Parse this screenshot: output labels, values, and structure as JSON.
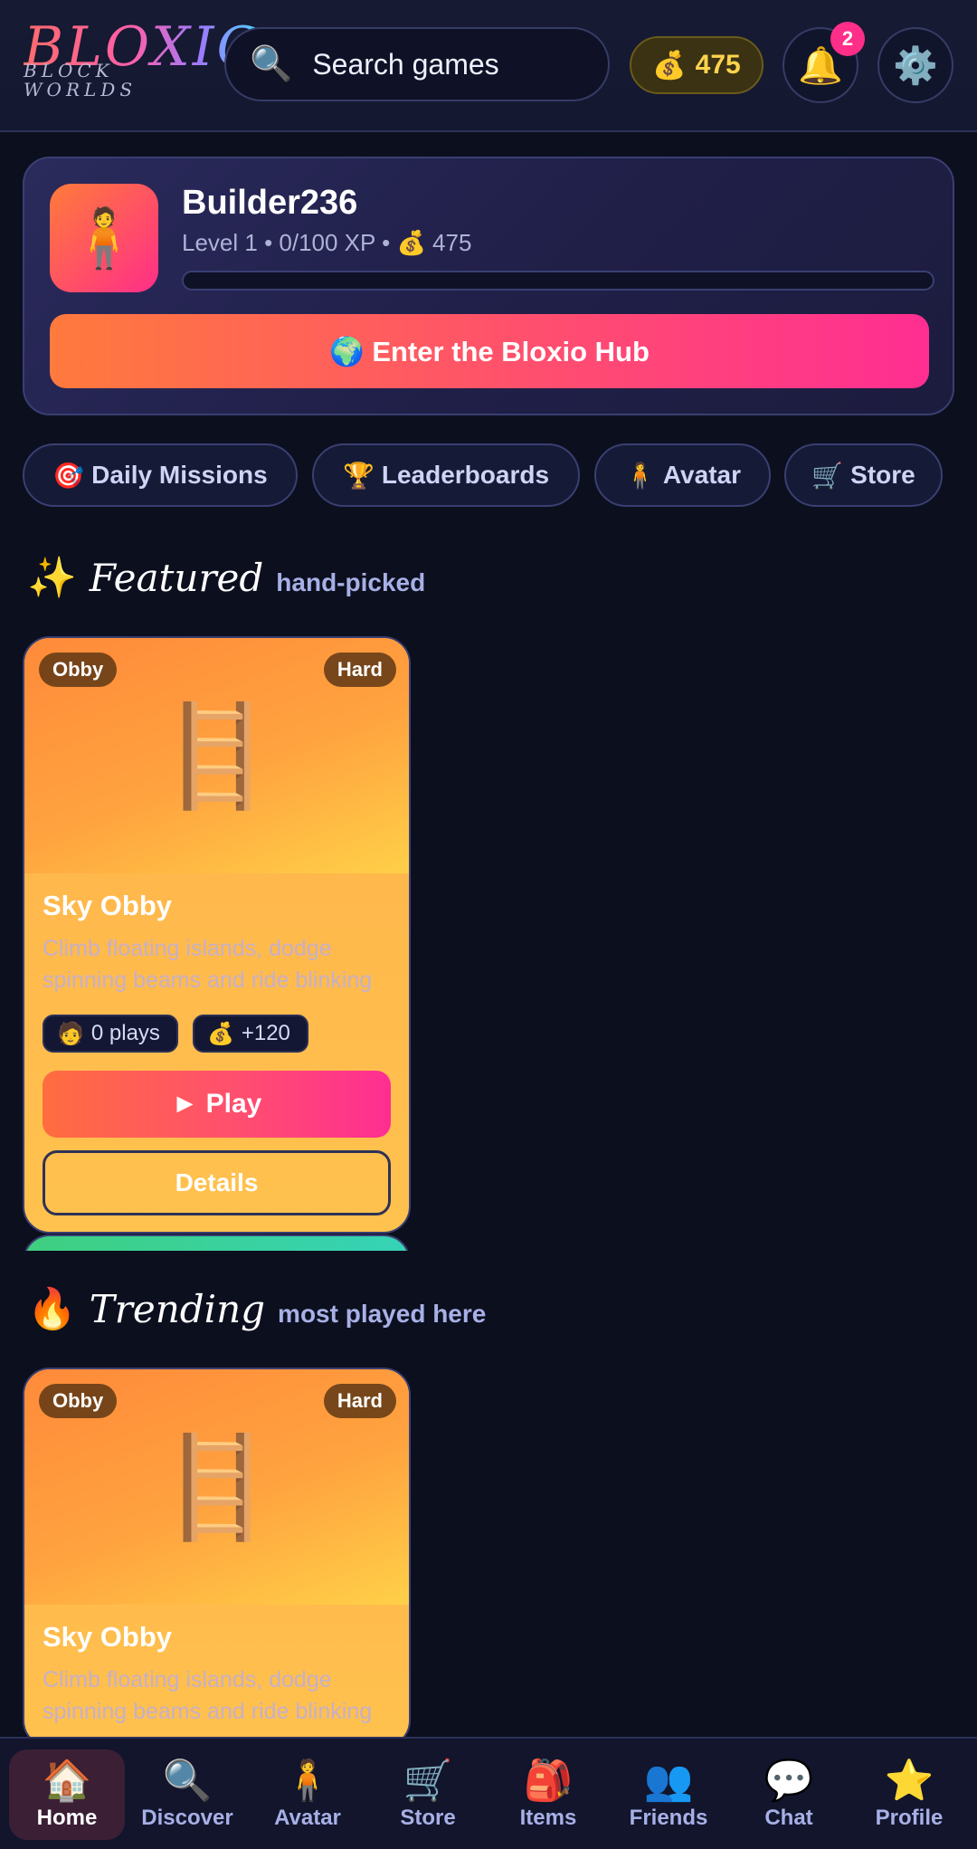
{
  "header": {
    "logo_main": "BLOXIC",
    "logo_sub": "BLOCK WORLDS",
    "search_icon": "🔍",
    "search_placeholder": "Search games",
    "coins_icon": "💰",
    "coins": "475",
    "bell_icon": "🔔",
    "notification_count": "2",
    "gear_icon": "⚙️"
  },
  "profile": {
    "avatar_icon": "🧍",
    "username": "Builder236",
    "level_line": "Level 1 • 0/100 XP • 💰 475",
    "xp_progress": 0,
    "hub_button": "🌍 Enter the Bloxio Hub"
  },
  "chips": [
    {
      "icon": "🎯",
      "label": "Daily Missions"
    },
    {
      "icon": "🏆",
      "label": "Leaderboards"
    },
    {
      "icon": "🧍",
      "label": "Avatar"
    },
    {
      "icon": "🛒",
      "label": "Store"
    }
  ],
  "featured": {
    "icon": "✨",
    "title": "Featured",
    "subtitle": "hand-picked",
    "card": {
      "genre": "Obby",
      "difficulty": "Hard",
      "glyph": "🪜",
      "title": "Sky Obby",
      "description": "Climb floating islands, dodge spinning beams and ride blinking",
      "plays_icon": "🧑",
      "plays": "0 plays",
      "reward_icon": "💰",
      "reward": "+120",
      "play_label": "► Play",
      "details_label": "Details"
    }
  },
  "trending": {
    "icon": "🔥",
    "title": "Trending",
    "subtitle": "most played here",
    "card": {
      "genre": "Obby",
      "difficulty": "Hard",
      "glyph": "🪜",
      "title": "Sky Obby",
      "description": "Climb floating islands, dodge spinning beams and ride blinking"
    }
  },
  "bottom_nav": [
    {
      "icon": "🏠",
      "label": "Home",
      "active": true
    },
    {
      "icon": "🔍",
      "label": "Discover"
    },
    {
      "icon": "🧍",
      "label": "Avatar"
    },
    {
      "icon": "🛒",
      "label": "Store"
    },
    {
      "icon": "🎒",
      "label": "Items"
    },
    {
      "icon": "👥",
      "label": "Friends"
    },
    {
      "icon": "💬",
      "label": "Chat"
    },
    {
      "icon": "⭐",
      "label": "Profile"
    }
  ],
  "colors": {
    "background": "#0c0f1e",
    "accent_orange": "#ff7a3d",
    "accent_pink": "#ff2e92",
    "card_orange": "#ffb14a",
    "coin_gold": "#ffd34d",
    "muted_text": "#a7b0e6"
  }
}
